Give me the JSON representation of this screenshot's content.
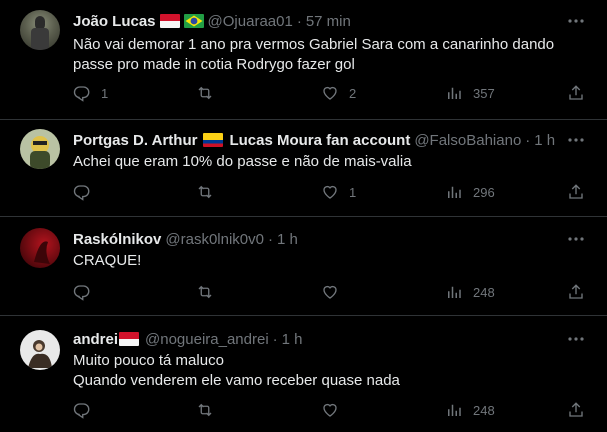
{
  "colors": {
    "background": "#000000",
    "text": "#e7e9ea",
    "secondary": "#71767b",
    "divider": "#2f3336"
  },
  "tweets": [
    {
      "name": "João Lucas",
      "flags": [
        "red-white-flag",
        "brazil-flag"
      ],
      "handle": "@Ojuaraa01",
      "time": "57 min",
      "lines": [
        "Não vai demorar 1 ano pra vermos Gabriel Sara com a canarinho dando",
        "passe pro made in cotia Rodrygo fazer gol"
      ],
      "replies": "1",
      "retweets": "",
      "likes": "2",
      "views": "357"
    },
    {
      "name": "Portgas D. Arthur",
      "flags": [
        "colombia-flag"
      ],
      "name2": "Lucas Moura fan account",
      "handle": "@FalsoBahiano",
      "time": "1 h",
      "lines": [
        "Achei que eram 10% do passe e não de mais-valia"
      ],
      "replies": "",
      "retweets": "",
      "likes": "1",
      "views": "296"
    },
    {
      "name": "Raskólnikov",
      "flags": [],
      "handle": "@rask0lnik0v0",
      "time": "1 h",
      "lines": [
        "CRAQUE!"
      ],
      "replies": "",
      "retweets": "",
      "likes": "",
      "views": "248"
    },
    {
      "name": "andrei",
      "flags": [
        "red-white-flag"
      ],
      "handle": "@nogueira_andrei",
      "time": "1 h",
      "lines": [
        "Muito pouco tá maluco",
        "Quando venderem ele vamo receber quase nada"
      ],
      "replies": "",
      "retweets": "",
      "likes": "",
      "views": "248"
    }
  ],
  "icons": {
    "reply": "reply-icon",
    "retweet": "retweet-icon",
    "like": "like-icon",
    "views": "views-icon",
    "share": "share-icon",
    "more": "more-icon"
  },
  "separator": "·"
}
